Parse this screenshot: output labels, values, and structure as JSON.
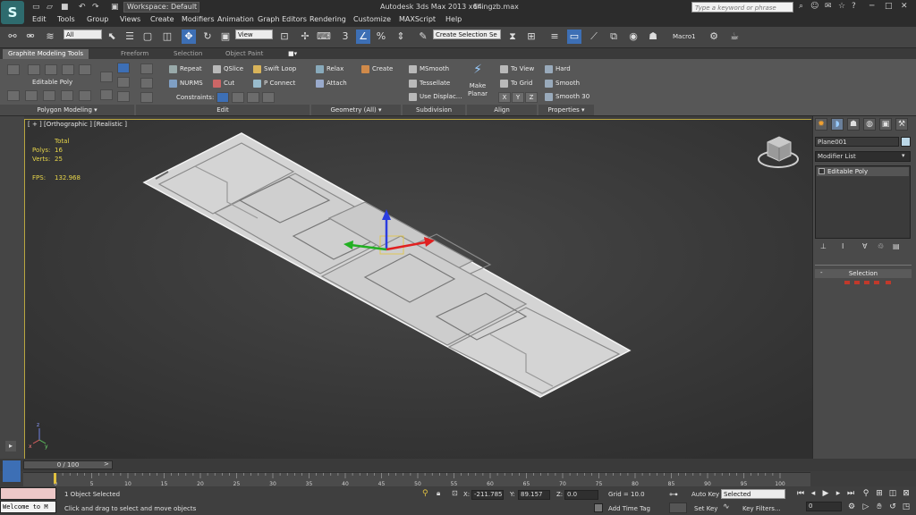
{
  "title_bar": {
    "app_title": "Autodesk 3ds Max  2013 x64",
    "file_name": "thingzb.max",
    "workspace": "Workspace: Default",
    "search_placeholder": "Type a keyword or phrase"
  },
  "menu": [
    "Edit",
    "Tools",
    "Group",
    "Views",
    "Create",
    "Modifiers",
    "Animation",
    "Graph Editors",
    "Rendering",
    "Customize",
    "MAXScript",
    "Help"
  ],
  "main_toolbar": {
    "filter_value": "All",
    "ref_coord_value": "View",
    "snap_label": "3",
    "named_selection_placeholder": "Create Selection Se",
    "macro_label": "Macro1"
  },
  "ribbon_tabs": [
    "Graphite Modeling Tools",
    "Freeform",
    "Selection",
    "Object Paint"
  ],
  "ribbon": {
    "polygon_modeling": {
      "mode_label": "Editable Poly",
      "footer": "Polygon Modeling ▾"
    },
    "edit": {
      "items": [
        "Repeat",
        "QSlice",
        "Swift Loop",
        "NURMS",
        "Cut",
        "P Connect"
      ],
      "constraints_label": "Constraints:",
      "footer": "Edit"
    },
    "geometry": {
      "items": [
        "Relax",
        "Create",
        "Attach"
      ],
      "footer": "Geometry (All) ▾"
    },
    "subdivision": {
      "items": [
        "MSmooth",
        "Tessellate",
        "Use Displac..."
      ],
      "footer": "Subdivision"
    },
    "align": {
      "make_planar": "Make\nPlanar",
      "items": [
        "To View",
        "To Grid"
      ],
      "xyz": [
        "X",
        "Y",
        "Z"
      ],
      "footer": "Align"
    },
    "properties": {
      "items": [
        "Hard",
        "Smooth",
        "Smooth 30"
      ],
      "footer": "Properties ▾"
    }
  },
  "viewport": {
    "label": "[ + ] [Orthographic ] [Realistic ]",
    "stats": {
      "header": "Total",
      "polys_label": "Polys:",
      "polys": "16",
      "verts_label": "Verts:",
      "verts": "25",
      "fps_label": "FPS:",
      "fps": "132.968"
    },
    "axis_labels": {
      "x": "x",
      "y": "y",
      "z": "z"
    }
  },
  "command_panel": {
    "tab_icons": [
      "sun-icon",
      "arc-icon",
      "hierarchy-icon",
      "motion-icon",
      "display-icon",
      "hammer-icon"
    ],
    "object_name": "Plane001",
    "object_color": "#bcd8e8",
    "modifier_list_label": "Modifier List",
    "stack_items": [
      "Editable Poly"
    ],
    "selection_rollout": "Selection"
  },
  "timeline": {
    "slider_label": "0 / 100",
    "ticks": [
      "0",
      "5",
      "10",
      "15",
      "20",
      "25",
      "30",
      "35",
      "40",
      "45",
      "50",
      "55",
      "60",
      "65",
      "70",
      "75",
      "80",
      "85",
      "90",
      "95",
      "100"
    ]
  },
  "status": {
    "maxscript_text": "Welcome to M",
    "selection_count": "1 Object Selected",
    "prompt": "Click and drag to select and move objects",
    "x_label": "X:",
    "x_value": "-211.785",
    "y_label": "Y:",
    "y_value": "89.157",
    "z_label": "Z:",
    "z_value": "0.0",
    "grid": "Grid = 10.0",
    "add_time_tag": "Add Time Tag",
    "auto_key": "Auto Key",
    "selected_value": "Selected",
    "set_key": "Set Key",
    "key_filters": "Key Filters...",
    "frame_value": "0"
  },
  "colors": {
    "accent_blue": "#3d6fb5",
    "viewport_border": "#b9a640",
    "stats_yellow": "#e7d54a",
    "gizmo_x": "#e02020",
    "gizmo_y": "#22b022",
    "gizmo_z": "#2a3de0"
  }
}
